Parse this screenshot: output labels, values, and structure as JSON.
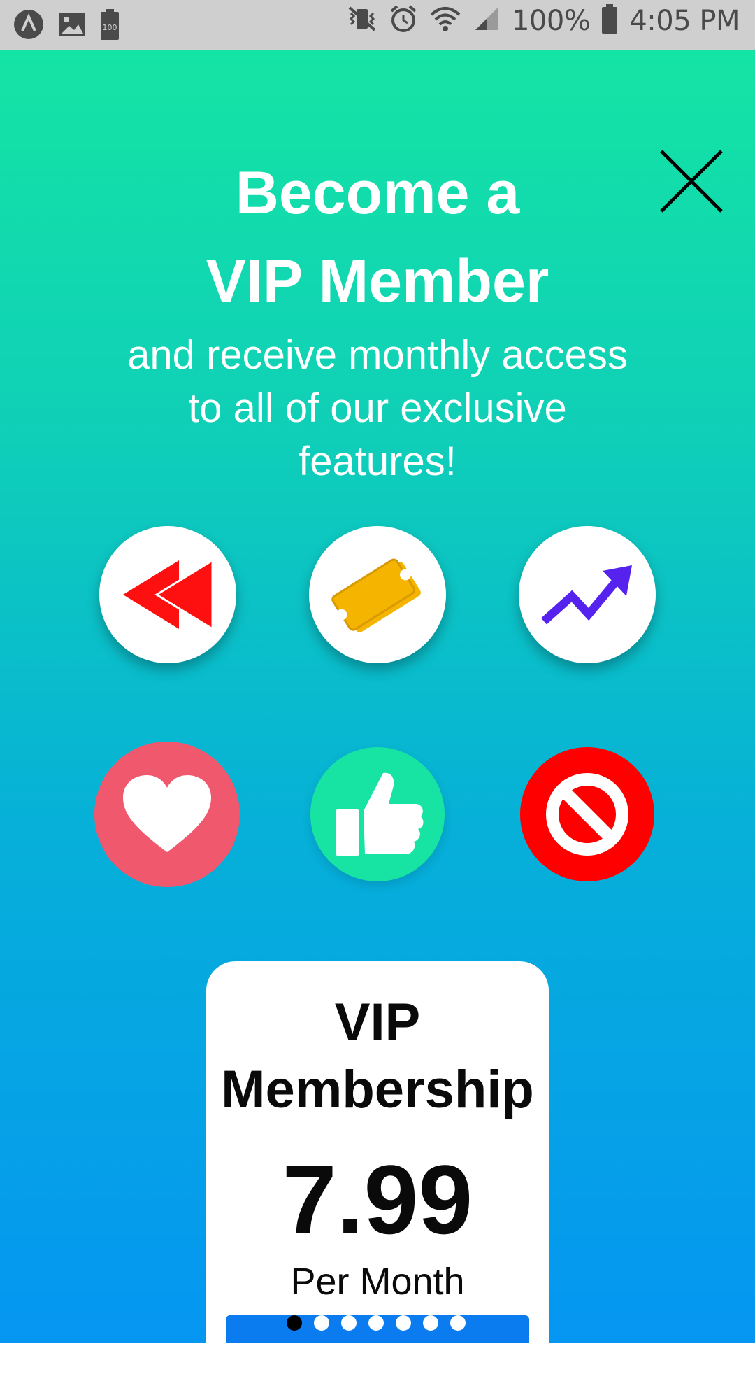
{
  "status_bar": {
    "battery_percent": "100%",
    "time": "4:05 PM",
    "icons": [
      "app-icon",
      "image-icon",
      "battery-saver-icon",
      "vibrate-icon",
      "alarm-icon",
      "wifi-icon",
      "signal-icon",
      "battery-icon"
    ]
  },
  "header": {
    "title_line1": "Become a",
    "title_line2": "VIP Member",
    "subtitle_line1": "and receive monthly access",
    "subtitle_line2": "to all of our exclusive",
    "subtitle_line3": "features!"
  },
  "features": [
    {
      "icon": "rewind-icon",
      "color": "#ff1010"
    },
    {
      "icon": "ticket-icon",
      "color": "#f4b400"
    },
    {
      "icon": "trending-up-icon",
      "color": "#5522ee"
    }
  ],
  "actions": [
    {
      "icon": "heart-icon",
      "bg": "#f0586e"
    },
    {
      "icon": "thumbs-up-icon",
      "bg": "#17e3a3"
    },
    {
      "icon": "block-icon",
      "bg": "#ff0000"
    }
  ],
  "plan": {
    "title_line1": "VIP",
    "title_line2": "Membership",
    "price": "7.99",
    "period": "Per Month"
  },
  "pager": {
    "count": 7,
    "active_index": 0
  },
  "colors": {
    "gradient_top": "#14e4a4",
    "gradient_bottom": "#0596f2",
    "button_blue": "#0a7cf0"
  }
}
